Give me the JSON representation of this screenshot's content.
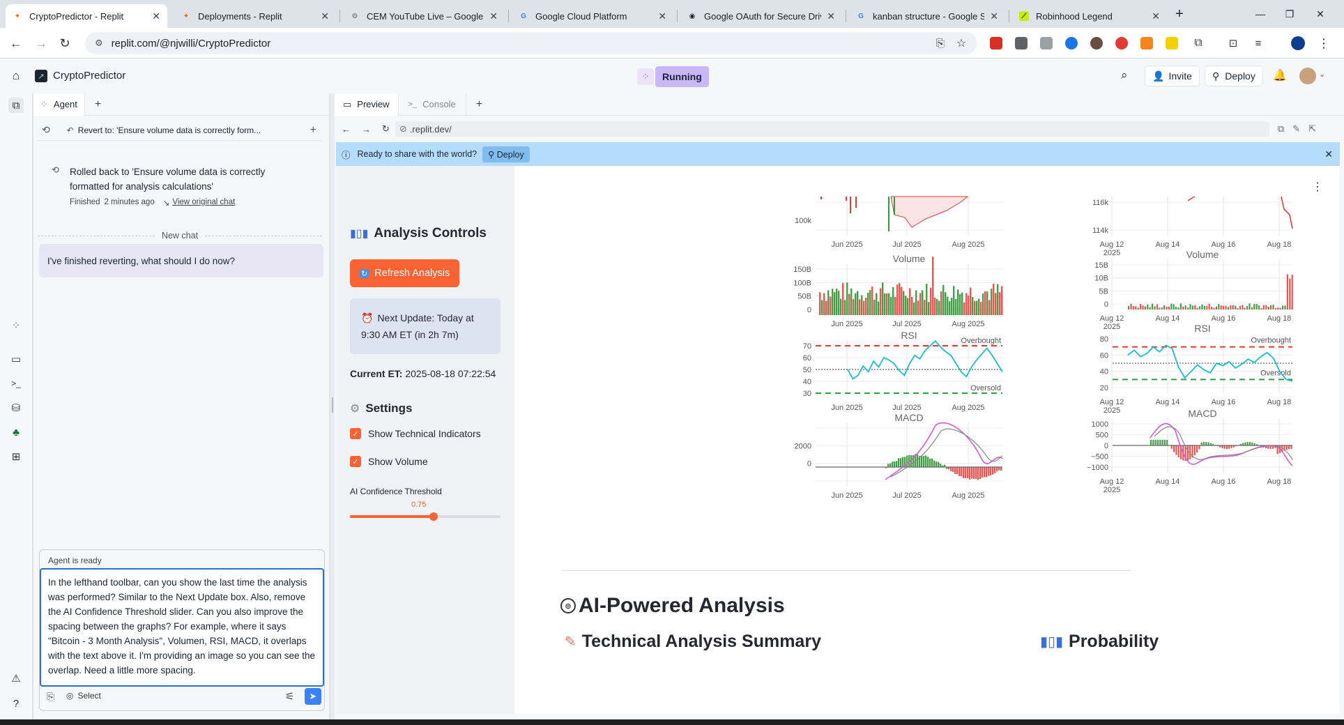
{
  "browser": {
    "tabs": [
      {
        "title": "CryptoPredictor - Replit",
        "color": "#f26207"
      },
      {
        "title": "Deployments - Replit",
        "color": "#f26207"
      },
      {
        "title": "CEM YouTube Live – Google Clo",
        "color": "#5f6368"
      },
      {
        "title": "Google Cloud Platform",
        "color": "#4285f4"
      },
      {
        "title": "Google OAuth for Secure Drive",
        "color": "#222222"
      },
      {
        "title": "kanban structure - Google Sear",
        "color": "#4285f4"
      },
      {
        "title": "Robinhood Legend",
        "color": "#c4f000"
      }
    ],
    "url": "replit.com/@njwilli/CryptoPredictor"
  },
  "replit": {
    "project_name": "CryptoPredictor",
    "status": "Running",
    "invite_label": "Invite",
    "deploy_label": "Deploy"
  },
  "agent": {
    "tab_label": "Agent",
    "revert_label": "Revert to: 'Ensure volume data is correctly form...",
    "rollback_text": "Rolled back to 'Ensure volume data is correctly formatted for analysis calculations'",
    "finished_label": "Finished",
    "finished_time": "2 minutes ago",
    "view_chat_link": "View original chat",
    "new_chat_label": "New chat",
    "user_message": "I've finished reverting, what should I do now?",
    "status": "Agent is ready",
    "input_text": "In the lefthand toolbar, can you show the last time the analysis was performed? Similar to the Next Update box. Also, remove the AI Confidence Threshold slider. Can you also improve the spacing between the graphs? For example, where it says \"Bitcoin - 3 Month Analysis\", Volumen, RSI, MACD, it overlaps with the text above it. I'm providing an image so you can see the overlap. Need a little more spacing.",
    "select_label": "Select"
  },
  "preview": {
    "tab_preview": "Preview",
    "tab_console": "Console",
    "url": ".replit.dev/",
    "banner_text": "Ready to share with the world?",
    "banner_button": "Deploy"
  },
  "app": {
    "controls_title": "Analysis Controls",
    "refresh_button": "Refresh Analysis",
    "next_update": "Next Update: Today at 9:30 AM ET (in 2h 7m)",
    "current_et_label": "Current ET:",
    "current_et_value": "2025-08-18 07:22:54",
    "settings_title": "Settings",
    "show_indicators": "Show Technical Indicators",
    "show_volume": "Show Volume",
    "slider_label": "AI Confidence Threshold",
    "slider_value": "0.75",
    "slider_fraction": 0.75,
    "ai_title": "AI-Powered Analysis",
    "tech_summary_title": "Technical Analysis Summary",
    "probability_title": "Probability"
  },
  "chart_data": [
    {
      "type": "line",
      "panels": [
        "Price",
        "Volume",
        "RSI",
        "MACD"
      ],
      "left_xticks": [
        "Jun 2025",
        "Jul 2025",
        "Aug 2025"
      ],
      "price_yticks": [
        "100k"
      ],
      "volume_title": "Volume",
      "volume_yticks": [
        "150B",
        "100B",
        "50B",
        "0"
      ],
      "rsi_title": "RSI",
      "rsi_yticks": [
        "70",
        "60",
        "50",
        "40",
        "30"
      ],
      "rsi_overbought": "Overbought",
      "rsi_oversold": "Oversold",
      "macd_title": "MACD",
      "macd_yticks": [
        "2000",
        "0"
      ],
      "rsi_values": [
        50,
        42,
        45,
        53,
        48,
        57,
        52,
        60,
        58,
        55,
        49,
        45,
        55,
        62,
        59,
        66,
        70,
        74,
        69,
        65,
        62,
        55,
        48,
        44,
        52,
        58,
        63,
        68,
        62,
        55,
        48
      ]
    },
    {
      "type": "line",
      "panels": [
        "Price",
        "Volume",
        "RSI",
        "MACD"
      ],
      "right_xticks": [
        "Aug 12\n2025",
        "Aug 14",
        "Aug 16",
        "Aug 18"
      ],
      "price_yticks": [
        "116k",
        "114k"
      ],
      "volume_title": "Volume",
      "volume_yticks": [
        "15B",
        "10B",
        "5B",
        "0"
      ],
      "rsi_title": "RSI",
      "rsi_yticks": [
        "80",
        "60",
        "40",
        "20"
      ],
      "rsi_overbought": "Overbought",
      "rsi_oversold": "Oversold",
      "macd_title": "MACD",
      "macd_yticks": [
        "1000",
        "500",
        "0",
        "−500",
        "−1000"
      ],
      "rsi_values": [
        60,
        66,
        58,
        62,
        70,
        64,
        72,
        68,
        45,
        32,
        40,
        48,
        42,
        38,
        50,
        47,
        52,
        44,
        49,
        55,
        51,
        58,
        63,
        56,
        40,
        30,
        28
      ]
    }
  ]
}
